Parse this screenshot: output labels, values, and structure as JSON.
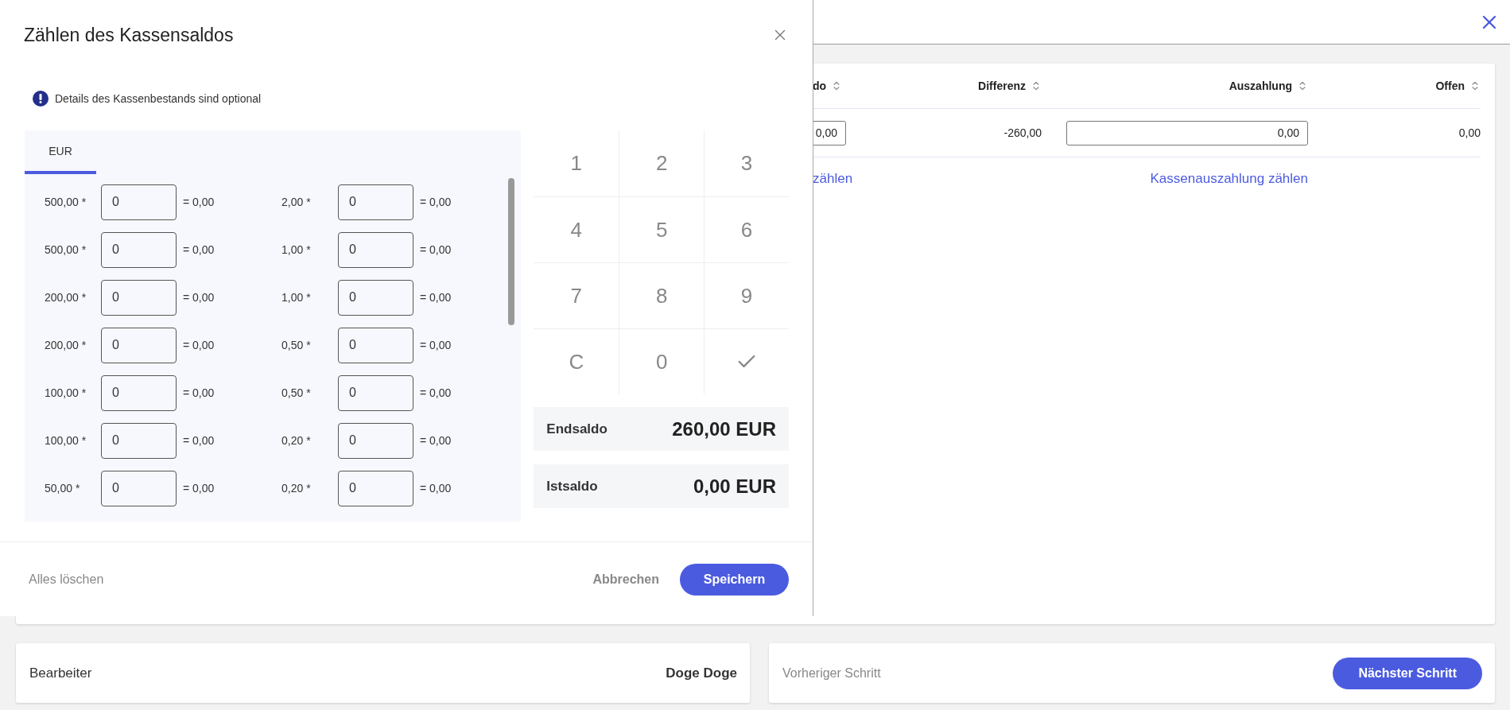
{
  "background": {
    "table": {
      "columns": [
        {
          "label": "do"
        },
        {
          "label": "Differenz"
        },
        {
          "label": "Auszahlung"
        },
        {
          "label": "Offen"
        }
      ],
      "row": [
        {
          "kind": "input",
          "value": "0,00"
        },
        {
          "kind": "text",
          "value": "-260,00"
        },
        {
          "kind": "input",
          "value": "0,00"
        },
        {
          "kind": "text",
          "value": "0,00"
        }
      ]
    },
    "links": [
      "zählen",
      "Kassenauszahlung zählen"
    ]
  },
  "dialog": {
    "title": "Zählen des Kassensaldos",
    "info": "Details des Kassenbestands sind optional",
    "tabs": [
      {
        "label": "EUR",
        "selected": true
      }
    ],
    "denominations": [
      {
        "label": "500,00 *",
        "value": "0",
        "total": "= 0,00"
      },
      {
        "label": "500,00 *",
        "value": "0",
        "total": "= 0,00"
      },
      {
        "label": "200,00 *",
        "value": "0",
        "total": "= 0,00"
      },
      {
        "label": "200,00 *",
        "value": "0",
        "total": "= 0,00"
      },
      {
        "label": "100,00 *",
        "value": "0",
        "total": "= 0,00"
      },
      {
        "label": "100,00 *",
        "value": "0",
        "total": "= 0,00"
      },
      {
        "label": "50,00 *",
        "value": "0",
        "total": "= 0,00"
      },
      {
        "label": "2,00 *",
        "value": "0",
        "total": "= 0,00"
      },
      {
        "label": "1,00 *",
        "value": "0",
        "total": "= 0,00"
      },
      {
        "label": "1,00 *",
        "value": "0",
        "total": "= 0,00"
      },
      {
        "label": "0,50 *",
        "value": "0",
        "total": "= 0,00"
      },
      {
        "label": "0,50 *",
        "value": "0",
        "total": "= 0,00"
      },
      {
        "label": "0,20 *",
        "value": "0",
        "total": "= 0,00"
      },
      {
        "label": "0,20 *",
        "value": "0",
        "total": "= 0,00"
      }
    ],
    "keypad": [
      {
        "kind": "key",
        "label": "1"
      },
      {
        "kind": "key",
        "label": "2"
      },
      {
        "kind": "key",
        "label": "3"
      },
      {
        "kind": "key",
        "label": "4"
      },
      {
        "kind": "key",
        "label": "5"
      },
      {
        "kind": "key",
        "label": "6"
      },
      {
        "kind": "key",
        "label": "7"
      },
      {
        "kind": "key",
        "label": "8"
      },
      {
        "kind": "key",
        "label": "9"
      },
      {
        "kind": "key",
        "label": "C"
      },
      {
        "kind": "key",
        "label": "0"
      },
      {
        "kind": "confirm"
      }
    ],
    "summary": [
      {
        "label": "Endsaldo",
        "value": "260,00 EUR"
      },
      {
        "label": "Istsaldo",
        "value": "0,00 EUR"
      }
    ],
    "footer": {
      "clear": "Alles löschen",
      "cancel": "Abbrechen",
      "save": "Speichern"
    }
  },
  "bottom": {
    "editor_label": "Bearbeiter",
    "editor_name": "Doge Doge",
    "previous": "Vorheriger Schritt",
    "next": "Nächster Schritt"
  }
}
